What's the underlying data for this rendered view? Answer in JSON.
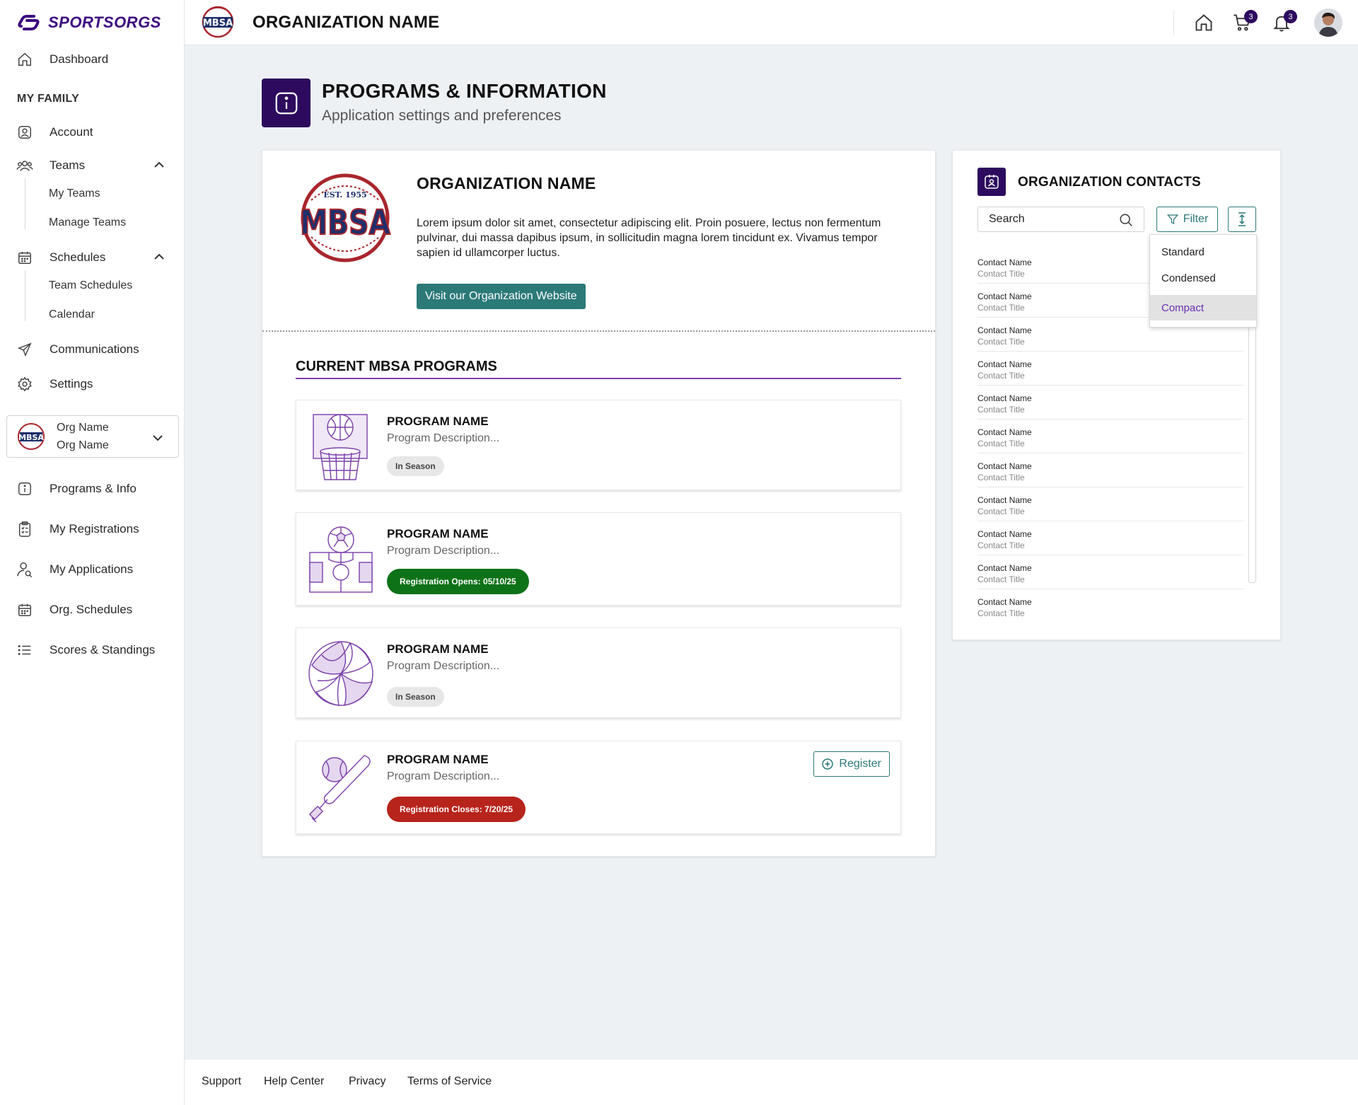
{
  "brand": {
    "name": "SPORTSORGS",
    "color": "#3d0a80"
  },
  "colors": {
    "primary_dark": "#2d0a5e",
    "teal": "#2b7a78",
    "green": "#0e7218",
    "red": "#b7241c",
    "accent_purple": "#7b3fa8"
  },
  "header": {
    "org_title": "ORGANIZATION NAME",
    "cart_count": "3",
    "notification_count": "3"
  },
  "sidebar": {
    "dashboard": "Dashboard",
    "my_family_label": "MY FAMILY",
    "account": "Account",
    "teams": "Teams",
    "my_teams": "My Teams",
    "manage_teams": "Manage Teams",
    "schedules": "Schedules",
    "team_schedules": "Team Schedules",
    "calendar": "Calendar",
    "communications": "Communications",
    "settings": "Settings",
    "org_select": {
      "line1": "Org Name",
      "line2": "Org Name"
    },
    "programs_info": "Programs & Info",
    "my_registrations": "My Registrations",
    "my_applications": "My Applications",
    "org_schedules": "Org. Schedules",
    "scores_standings": "Scores & Standings"
  },
  "page": {
    "title": "PROGRAMS & INFORMATION",
    "subtitle": "Application settings and preferences"
  },
  "org_card": {
    "logo_top": "EST. 1955",
    "logo_main": "MBSA",
    "name": "ORGANIZATION NAME",
    "description": "Lorem ipsum dolor sit amet, consectetur adipiscing elit. Proin posuere, lectus non fermentum pulvinar, dui massa dapibus ipsum, in sollicitudin magna lorem tincidunt ex. Vivamus tempor sapien id ullamcorper luctus.",
    "website_button": "Visit our Organization Website",
    "programs_heading": "CURRENT MBSA PROGRAMS"
  },
  "programs": [
    {
      "icon": "basketball-icon",
      "name": "PROGRAM NAME",
      "description": "Program Description...",
      "status": "In Season"
    },
    {
      "icon": "soccer-field-icon",
      "name": "PROGRAM NAME",
      "description": "Program Description...",
      "status": "Registration Opens: 05/10/25"
    },
    {
      "icon": "volleyball-icon",
      "name": "PROGRAM NAME",
      "description": "Program Description...",
      "status": "In Season"
    },
    {
      "icon": "baseball-bat-icon",
      "name": "PROGRAM NAME",
      "description": "Program Description...",
      "status": "Registration Closes: 7/20/25",
      "register_label": "Register"
    }
  ],
  "contacts": {
    "title": "ORGANIZATION CONTACTS",
    "search_placeholder": "Search",
    "filter_label": "Filter",
    "density_options": [
      "Standard",
      "Condensed",
      "Compact"
    ],
    "density_selected": "Compact",
    "items": [
      {
        "name": "Contact Name",
        "title": "Contact Title"
      },
      {
        "name": "Contact Name",
        "title": "Contact Title"
      },
      {
        "name": "Contact Name",
        "title": "Contact Title"
      },
      {
        "name": "Contact Name",
        "title": "Contact Title"
      },
      {
        "name": "Contact Name",
        "title": "Contact Title"
      },
      {
        "name": "Contact Name",
        "title": "Contact Title"
      },
      {
        "name": "Contact Name",
        "title": "Contact Title"
      },
      {
        "name": "Contact Name",
        "title": "Contact Title"
      },
      {
        "name": "Contact Name",
        "title": "Contact Title"
      },
      {
        "name": "Contact Name",
        "title": "Contact Title"
      },
      {
        "name": "Contact Name",
        "title": "Contact Title"
      }
    ]
  },
  "footer": {
    "support": "Support",
    "help_center": "Help Center",
    "privacy": "Privacy",
    "terms": "Terms of Service"
  }
}
